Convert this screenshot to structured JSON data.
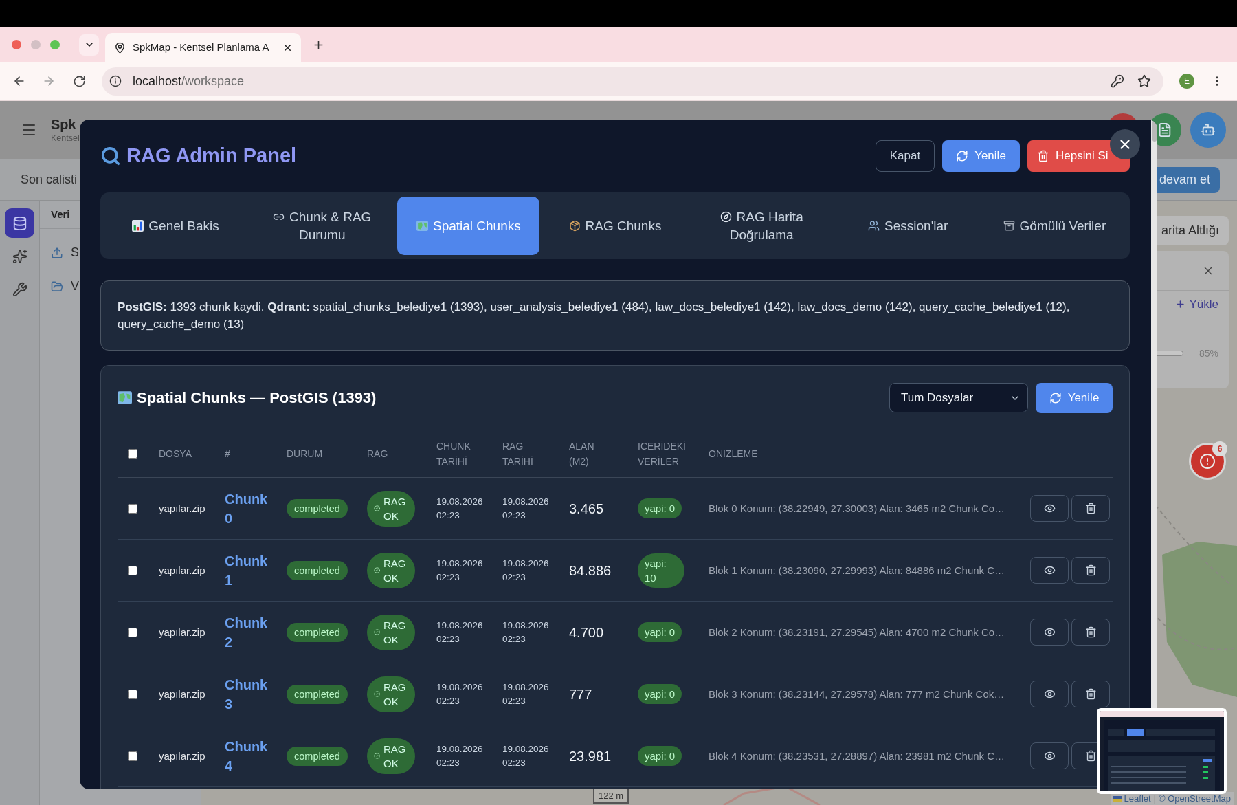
{
  "browser": {
    "tab_title": "SpkMap - Kentsel Planlama A",
    "url_host": "localhost",
    "url_path": "/workspace",
    "profile_initial": "E"
  },
  "app": {
    "brand": "Spk",
    "subtitle": "Kentsel",
    "header_buttons": [
      {
        "kind": "plain",
        "color": "#b23c3c"
      },
      {
        "kind": "document",
        "color": "#3a8551"
      },
      {
        "kind": "robot",
        "color": "#3b7cbd"
      }
    ],
    "banner_text": "Son calisti",
    "banner_button": "devam et",
    "sidebar": [
      {
        "kind": "database",
        "selected": true
      },
      {
        "kind": "sparkles",
        "selected": false
      },
      {
        "kind": "wrench",
        "selected": false
      }
    ],
    "panel_title": "Veri",
    "panel_items": [
      {
        "kind": "upload",
        "label": "S"
      },
      {
        "kind": "folder",
        "label": "V"
      }
    ]
  },
  "map": {
    "basemap_button": "arita Altlığı",
    "upload_button": "Yükle",
    "progress_reading": "85%",
    "alert_count": "6",
    "scale": "122 m",
    "attribution": {
      "link": "Leaflet",
      "separator": "|",
      "credit": "© OpenStreetMap"
    }
  },
  "modal": {
    "title": "RAG Admin Panel",
    "actions": [
      {
        "kind": "outline",
        "label": "Kapat"
      },
      {
        "kind": "refresh",
        "label": "Yenile"
      },
      {
        "kind": "delete",
        "label": "Hepsini Si"
      }
    ],
    "tabs": [
      {
        "kind": "chart",
        "label": "Genel Bakis",
        "selected": false
      },
      {
        "kind": "link",
        "label": "Chunk & RAG Durumu",
        "selected": false
      },
      {
        "kind": "map",
        "label": "Spatial Chunks",
        "selected": true
      },
      {
        "kind": "package",
        "label": "RAG Chunks",
        "selected": false
      },
      {
        "kind": "compass",
        "label": "RAG Harita Doğrulama",
        "selected": false
      },
      {
        "kind": "people",
        "label": "Session'lar",
        "selected": false
      },
      {
        "kind": "cabinet",
        "label": "Gömülü Veriler",
        "selected": false
      }
    ],
    "summary": "**PostGIS:** 1393 chunk kaydi. **Qdrant:** spatial_chunks_belediye1 (1393), user_analysis_belediye1 (484), law_docs_belediye1 (142), law_docs_demo (142), query_cache_belediye1 (12), query_cache_demo (13)",
    "section": {
      "title": "Spatial Chunks — PostGIS (1393)",
      "filter": "Tum Dosyalar",
      "refresh": "Yenile",
      "select_all_checked": false,
      "columns": [
        "DOSYA",
        "#",
        "DURUM",
        "RAG",
        "CHUNK TARİHİ",
        "RAG TARİHİ",
        "ALAN (M2)",
        "ICERİDEKİ VERİLER",
        "ONIZLEME"
      ],
      "rows": [
        {
          "checked": false,
          "file": "yapılar.zip",
          "chunk": "Chunk 0",
          "status": "completed",
          "rag": "RAG OK",
          "chunk_date": "19.08.2026 02:23",
          "rag_date": "19.08.2026 02:23",
          "area": "3.465",
          "contents": "yapi: 0",
          "preview": "Blok 0 Konum: (38.22949, 27.30003) Alan: 3465 m2 Chunk Co…"
        },
        {
          "checked": false,
          "file": "yapılar.zip",
          "chunk": "Chunk 1",
          "status": "completed",
          "rag": "RAG OK",
          "chunk_date": "19.08.2026 02:23",
          "rag_date": "19.08.2026 02:23",
          "area": "84.886",
          "contents": "yapi: 10",
          "preview": "Blok 1 Konum: (38.23090, 27.29993) Alan: 84886 m2 Chunk C…"
        },
        {
          "checked": false,
          "file": "yapılar.zip",
          "chunk": "Chunk 2",
          "status": "completed",
          "rag": "RAG OK",
          "chunk_date": "19.08.2026 02:23",
          "rag_date": "19.08.2026 02:23",
          "area": "4.700",
          "contents": "yapi: 0",
          "preview": "Blok 2 Konum: (38.23191, 27.29545) Alan: 4700 m2 Chunk Co…"
        },
        {
          "checked": false,
          "file": "yapılar.zip",
          "chunk": "Chunk 3",
          "status": "completed",
          "rag": "RAG OK",
          "chunk_date": "19.08.2026 02:23",
          "rag_date": "19.08.2026 02:23",
          "area": "777",
          "contents": "yapi: 0",
          "preview": "Blok 3 Konum: (38.23144, 27.29578) Alan: 777 m2 Chunk Cok…"
        },
        {
          "checked": false,
          "file": "yapılar.zip",
          "chunk": "Chunk 4",
          "status": "completed",
          "rag": "RAG OK",
          "chunk_date": "19.08.2026 02:23",
          "rag_date": "19.08.2026 02:23",
          "area": "23.981",
          "contents": "yapi: 0",
          "preview": "Blok 4 Konum: (38.23531, 27.28897) Alan: 23981 m2 Chunk C…"
        }
      ]
    }
  }
}
